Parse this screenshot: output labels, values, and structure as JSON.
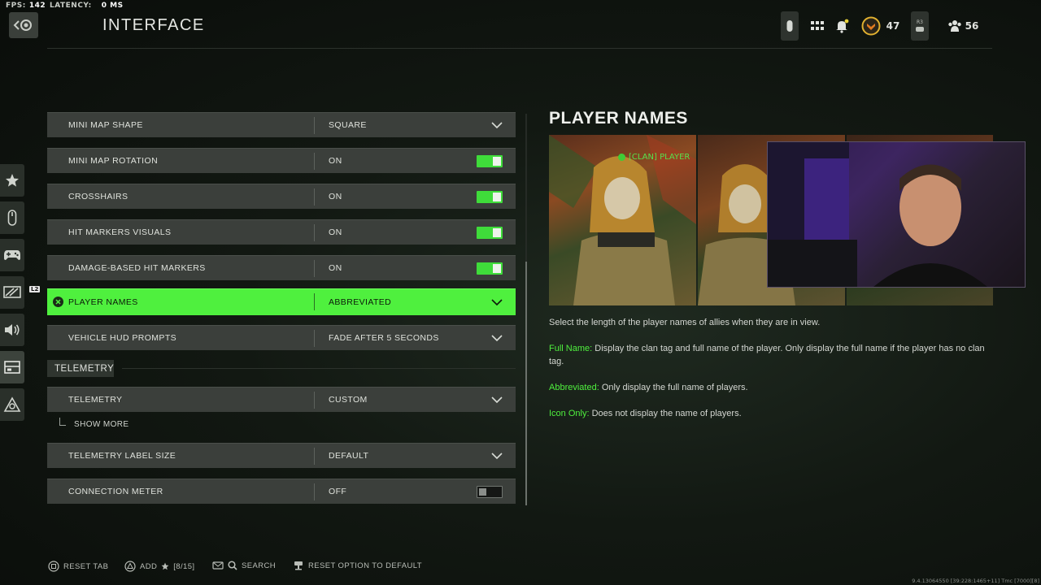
{
  "stats": {
    "fps_label": "FPS:",
    "fps_value": "142",
    "latency_label": "LATENCY:",
    "latency_value": "0 MS"
  },
  "header": {
    "title": "INTERFACE"
  },
  "topbar": {
    "level": "47",
    "r3_label": "R3",
    "party_count": "56"
  },
  "sidebar": {
    "badge": "L2",
    "items": [
      "star-icon",
      "mouse-icon",
      "controller-icon",
      "display-icon",
      "audio-icon",
      "interface-icon",
      "network-icon"
    ],
    "active_index": 5
  },
  "settings": [
    {
      "label": "MINI MAP SHAPE",
      "value": "SQUARE",
      "control": "dropdown"
    },
    {
      "label": "MINI MAP ROTATION",
      "value": "ON",
      "control": "toggle",
      "on": true
    },
    {
      "label": "CROSSHAIRS",
      "value": "ON",
      "control": "toggle",
      "on": true
    },
    {
      "label": "HIT MARKERS VISUALS",
      "value": "ON",
      "control": "toggle",
      "on": true
    },
    {
      "label": "DAMAGE-BASED HIT MARKERS",
      "value": "ON",
      "control": "toggle",
      "on": true
    },
    {
      "label": "PLAYER NAMES",
      "value": "ABBREVIATED",
      "control": "dropdown",
      "selected": true
    },
    {
      "label": "VEHICLE HUD PROMPTS",
      "value": "FADE AFTER 5 SECONDS",
      "control": "dropdown"
    }
  ],
  "section": {
    "title": "TELEMETRY"
  },
  "telemetry": [
    {
      "label": "TELEMETRY",
      "value": "CUSTOM",
      "control": "dropdown"
    },
    {
      "label": "TELEMETRY LABEL SIZE",
      "value": "DEFAULT",
      "control": "dropdown"
    },
    {
      "label": "CONNECTION METER",
      "value": "OFF",
      "control": "toggle",
      "on": false
    }
  ],
  "show_more": "SHOW MORE",
  "detail": {
    "title": "PLAYER NAMES",
    "clan_tag": "[CLAN] PLAYER",
    "intro": "Select the length of the player names of allies when they are in view.",
    "options": [
      {
        "term": "Full Name:",
        "text": " Display the clan tag and full name of the player. Only display the full name if the player has no clan tag."
      },
      {
        "term": "Abbreviated:",
        "text": " Only display the full name of players."
      },
      {
        "term": "Icon Only:",
        "text": " Does not display the name of players."
      }
    ]
  },
  "footer": {
    "reset_tab": "RESET TAB",
    "add": "ADD",
    "add_count": "[8/15]",
    "search": "SEARCH",
    "reset_option": "RESET OPTION TO DEFAULT"
  },
  "version": "9.4.13064550 [39:228:1465+11] Tmc [7000][8]",
  "colors": {
    "accent": "#4ff03e",
    "row_bg": "#3b3f3b",
    "toggle_on": "#3fdc3a"
  }
}
